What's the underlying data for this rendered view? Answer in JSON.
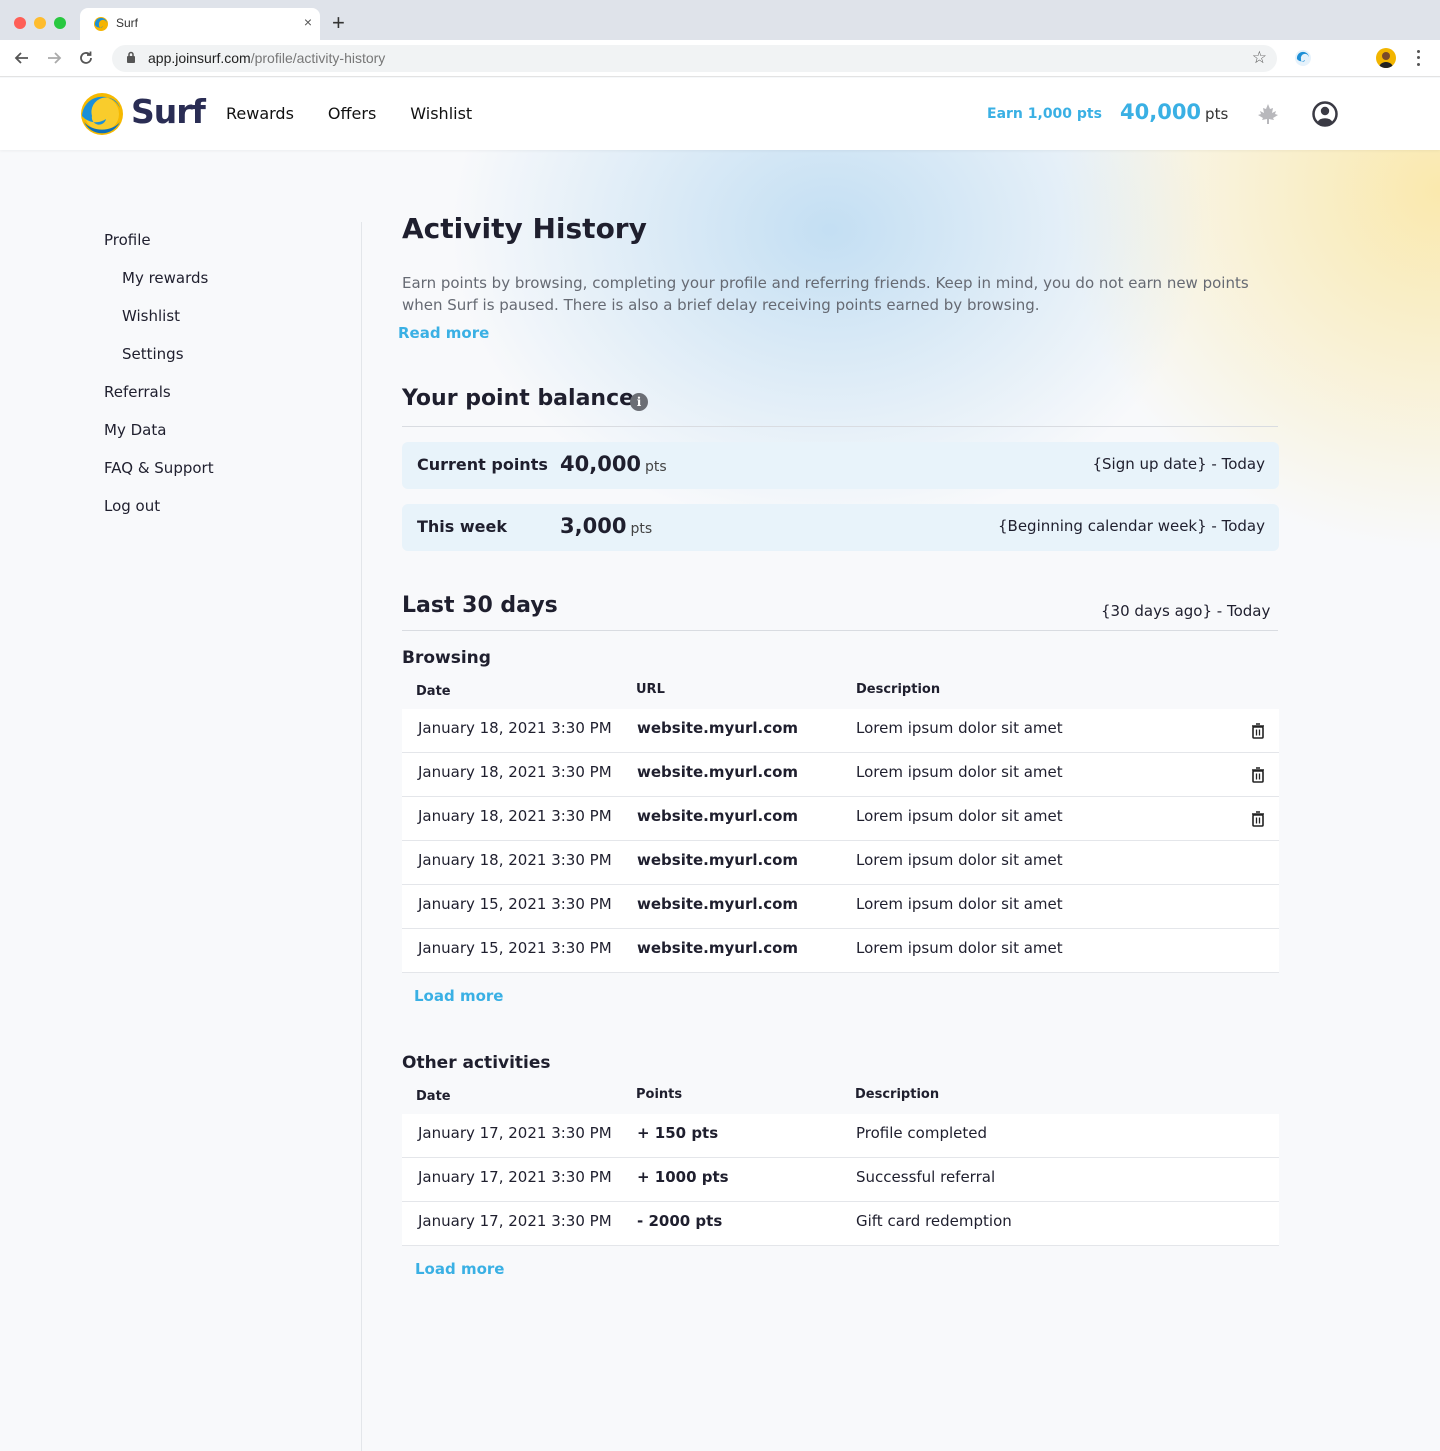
{
  "browser": {
    "tab_title": "Surf",
    "tab_close": "×",
    "new_tab": "+",
    "url_host": "app.joinsurf.com",
    "url_path": "/profile/activity-history"
  },
  "header": {
    "logo_text": "Surf",
    "nav": [
      "Rewards",
      "Offers",
      "Wishlist"
    ],
    "earn_link": "Earn 1,000 pts",
    "balance_value": "40,000",
    "balance_unit": "pts"
  },
  "sidebar": {
    "items": [
      {
        "label": "Profile"
      },
      {
        "label": "My rewards"
      },
      {
        "label": "Wishlist"
      },
      {
        "label": "Settings"
      },
      {
        "label": "Referrals"
      },
      {
        "label": "My Data"
      },
      {
        "label": "FAQ & Support"
      },
      {
        "label": "Log out"
      }
    ]
  },
  "page": {
    "title": "Activity History",
    "intro": "Earn points by browsing, completing your profile and referring friends. Keep in mind, you do not earn new points when Surf is paused. There is also a brief delay receiving points earned by browsing.",
    "read_more": "Read more"
  },
  "balance_section": {
    "title": "Your point balance",
    "info_glyph": "i",
    "current": {
      "label": "Current points",
      "value": "40,000",
      "unit": "pts",
      "range": "{Sign up date} - Today"
    },
    "week": {
      "label": "This week",
      "value": "3,000",
      "unit": "pts",
      "range": "{Beginning calendar week} - Today"
    }
  },
  "last30": {
    "title": "Last 30 days",
    "range": "{30 days ago} - Today",
    "browsing": {
      "title": "Browsing",
      "headers": {
        "date": "Date",
        "url": "URL",
        "description": "Description"
      },
      "rows": [
        {
          "date": "January 18, 2021 3:30 PM",
          "url": "website.myurl.com",
          "description": "Lorem ipsum dolor sit amet",
          "deletable": true
        },
        {
          "date": "January 18, 2021 3:30 PM",
          "url": "website.myurl.com",
          "description": "Lorem ipsum dolor sit amet",
          "deletable": true
        },
        {
          "date": "January 18, 2021 3:30 PM",
          "url": "website.myurl.com",
          "description": "Lorem ipsum dolor sit amet",
          "deletable": true
        },
        {
          "date": "January 18, 2021 3:30 PM",
          "url": "website.myurl.com",
          "description": "Lorem ipsum dolor sit amet",
          "deletable": false
        },
        {
          "date": "January 15, 2021 3:30 PM",
          "url": "website.myurl.com",
          "description": "Lorem ipsum dolor sit amet",
          "deletable": false
        },
        {
          "date": "January 15, 2021 3:30 PM",
          "url": "website.myurl.com",
          "description": "Lorem ipsum dolor sit amet",
          "deletable": false
        }
      ],
      "load_more": "Load more"
    },
    "other": {
      "title": "Other activities",
      "headers": {
        "date": "Date",
        "points": "Points",
        "description": "Description"
      },
      "rows": [
        {
          "date": "January 17, 2021 3:30 PM",
          "points": "+ 150 pts",
          "description": "Profile completed"
        },
        {
          "date": "January 17, 2021 3:30 PM",
          "points": "+ 1000 pts",
          "description": "Successful referral"
        },
        {
          "date": "January 17, 2021 3:30 PM",
          "points": "- 2000 pts",
          "description": "Gift card redemption"
        }
      ],
      "load_more": "Load more"
    }
  },
  "colors": {
    "accent": "#3ab0e4",
    "brand_text": "#2a2d54",
    "card_bg": "#e8f3fa"
  }
}
